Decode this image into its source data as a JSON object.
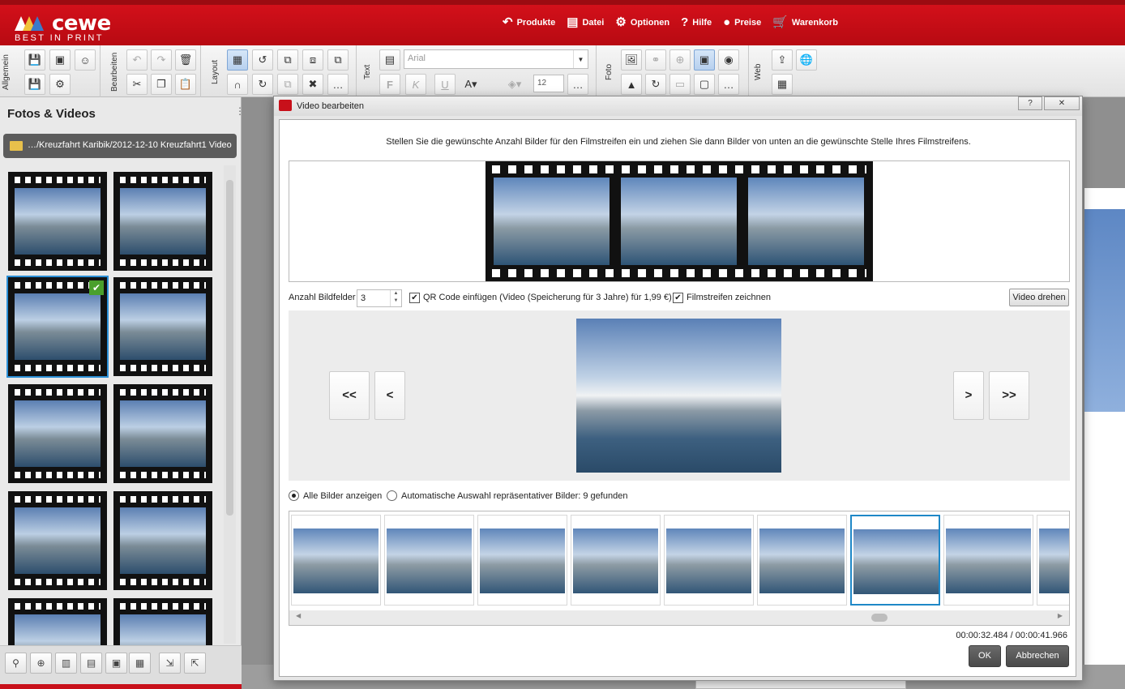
{
  "brand": {
    "name": "cewe",
    "tagline": "BEST IN PRINT"
  },
  "menu": [
    {
      "label": "Produkte",
      "icon": "arrow-icon"
    },
    {
      "label": "Datei",
      "icon": "folder-icon"
    },
    {
      "label": "Optionen",
      "icon": "gear-icon"
    },
    {
      "label": "Hilfe",
      "icon": "question-icon"
    },
    {
      "label": "Preise",
      "icon": "coins-icon"
    },
    {
      "label": "Warenkorb",
      "icon": "cart-icon"
    }
  ],
  "ribbon": {
    "groups": [
      "Allgemein",
      "Bearbeiten",
      "Layout",
      "Text",
      "Foto",
      "Web"
    ],
    "font": "Arial",
    "font_size": "12",
    "bold": "F",
    "italic": "K",
    "underline": "U"
  },
  "left_panel": {
    "title": "Fotos & Videos",
    "path": "…/Kreuzfahrt Karibik/2012-12-10 Kreuzfahrt1 Video"
  },
  "dialog": {
    "title": "Video bearbeiten",
    "help": "?",
    "close": "✕",
    "instruction": "Stellen Sie die gewünschte Anzahl Bilder für den Filmstreifen ein und ziehen Sie dann Bilder von unten an die gewünschte Stelle Ihres Filmstreifens.",
    "count_label": "Anzahl Bildfelder",
    "count_value": "3",
    "qr_label": "QR Code einfügen (Video (Speicherung für 3 Jahre) für 1,99 €)",
    "qr_checked": true,
    "film_label": "Filmstreifen zeichnen",
    "film_checked": true,
    "rotate_button": "Video drehen",
    "nav": {
      "first": "<<",
      "prev": "<",
      "next": ">",
      "last": ">>"
    },
    "radio_all": "Alle Bilder anzeigen",
    "radio_auto": "Automatische Auswahl repräsentativer Bilder: 9 gefunden",
    "timecode": "00:00:32.484 / 00:00:41.966",
    "ok": "OK",
    "cancel": "Abbrechen"
  }
}
